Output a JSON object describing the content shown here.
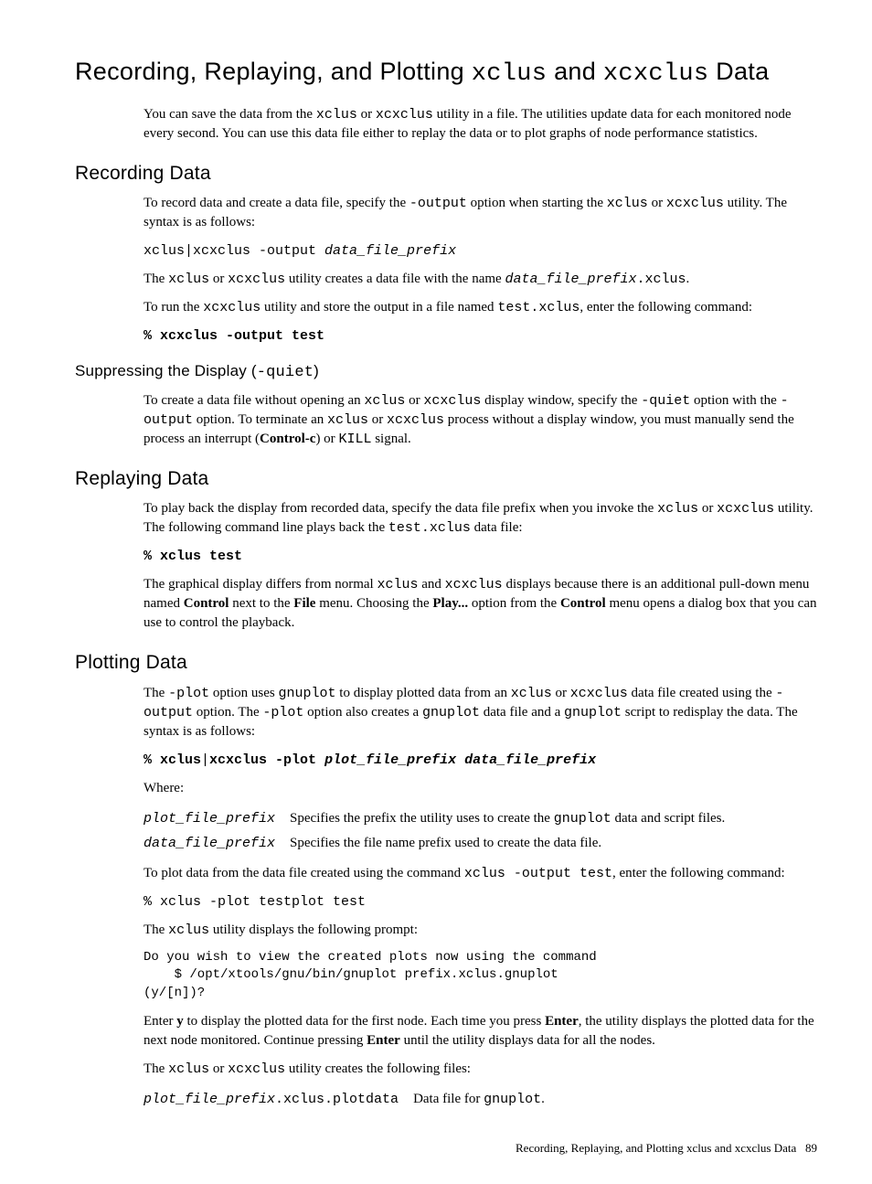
{
  "title": {
    "pre": "Recording, Replaying, and Plotting ",
    "code1": "xclus",
    "mid": " and ",
    "code2": "xcxclus",
    "post": " Data"
  },
  "intro": {
    "t1": "You can save the data from the ",
    "c1": "xclus",
    "t2": " or ",
    "c2": "xcxclus",
    "t3": " utility in a file. The utilities update data for each monitored node every second. You can use this data file either to replay the data or to plot graphs of node performance statistics."
  },
  "recording": {
    "heading": "Recording Data",
    "p1_t1": "To record data and create a data file, specify the ",
    "p1_c1": "-output",
    "p1_t2": " option when starting the ",
    "p1_c2": "xclus",
    "p1_t3": " or ",
    "p1_c3": "xcxclus",
    "p1_t4": " utility. The syntax is as follows:",
    "syntax_c1": "xclus|xcxclus -output ",
    "syntax_i1": "data_file_prefix",
    "p2_t1": "The ",
    "p2_c1": "xclus",
    "p2_t2": " or ",
    "p2_c2": "xcxclus",
    "p2_t3": " utility creates a data file with the name ",
    "p2_i1": "data_file_prefix",
    "p2_c3": ".xclus",
    "p2_t4": ".",
    "p3_t1": "To run the ",
    "p3_c1": "xcxclus",
    "p3_t2": " utility and store the output in a file named ",
    "p3_c2": "test.xclus",
    "p3_t3": ", enter the following command:",
    "cmd1": "% xcxclus -output test"
  },
  "suppress": {
    "heading_t1": "Suppressing the Display (",
    "heading_c1": "-quiet",
    "heading_t2": ")",
    "p1_t1": "To create a data file without opening an ",
    "p1_c1": "xclus",
    "p1_t2": " or ",
    "p1_c2": "xcxclus",
    "p1_t3": " display window, specify the ",
    "p1_c3": "-quiet",
    "p1_t4": " option with the  ",
    "p1_c4": "-output",
    "p1_t5": " option. To terminate an ",
    "p1_c5": "xclus",
    "p1_t6": " or ",
    "p1_c6": "xcxclus",
    "p1_t7": " process without a display window, you must manually send the process an interrupt (",
    "p1_b1": "Control-c",
    "p1_t8": ") or ",
    "p1_c7": "KILL",
    "p1_t9": " signal."
  },
  "replay": {
    "heading": "Replaying Data",
    "p1_t1": "To play back the display from recorded data, specify the data file prefix when you invoke the ",
    "p1_c1": "xclus",
    "p1_t2": " or ",
    "p1_c2": "xcxclus",
    "p1_t3": " utility. The following command line plays back the ",
    "p1_c3": "test.xclus",
    "p1_t4": " data file:",
    "cmd1": "% xclus test",
    "p2_t1": "The graphical display differs from normal ",
    "p2_c1": "xclus",
    "p2_t2": " and ",
    "p2_c2": "xcxclus",
    "p2_t3": " displays because there is an additional pull-down menu named ",
    "p2_b1": "Control",
    "p2_t4": " next to the ",
    "p2_b2": "File",
    "p2_t5": " menu. Choosing the ",
    "p2_b3": "Play...",
    "p2_t6": " option from the ",
    "p2_b4": "Control",
    "p2_t7": " menu opens a dialog box that you can use to control the playback."
  },
  "plot": {
    "heading": "Plotting Data",
    "p1_t1": "The ",
    "p1_c1": "-plot",
    "p1_t2": " option uses ",
    "p1_c2": "gnuplot",
    "p1_t3": " to display plotted data from an ",
    "p1_c3": "xclus",
    "p1_t4": " or ",
    "p1_c4": "xcxclus",
    "p1_t5": " data file created using the ",
    "p1_c5": "-output",
    "p1_t6": " option. The ",
    "p1_c6": "-plot",
    "p1_t7": " option also creates a ",
    "p1_c7": "gnuplot",
    "p1_t8": " data file and a ",
    "p1_c8": "gnuplot",
    "p1_t9": " script to redisplay the data. The syntax is as follows:",
    "cmd1_a": "% xclus",
    "cmd1_b": "|",
    "cmd1_c": "xcxclus -plot ",
    "cmd1_i1": "plot_file_prefix data_file_prefix",
    "where": "Where:",
    "row1_k": "plot_file_prefix",
    "row1_v_t1": "Specifies the prefix the utility uses to create the ",
    "row1_v_c1": "gnuplot",
    "row1_v_t2": " data and script files.",
    "row2_k": "data_file_prefix",
    "row2_v": "Specifies the file name prefix used to create the data file.",
    "p2_t1": "To plot data from the data file created using the command ",
    "p2_c1": "xclus -output test",
    "p2_t2": ", enter the following command:",
    "cmd2": "% xclus -plot testplot test",
    "p3_t1": "The ",
    "p3_c1": "xclus",
    "p3_t2": " utility displays the following prompt:",
    "code": "Do you wish to view the created plots now using the command\n    $ /opt/xtools/gnu/bin/gnuplot prefix.xclus.gnuplot\n(y/[n])?",
    "p4_t1": "Enter ",
    "p4_b1": "y",
    "p4_t2": " to display the plotted data for the first node. Each time you press ",
    "p4_b2": "Enter",
    "p4_t3": ", the utility displays the plotted data for the next node monitored. Continue pressing ",
    "p4_b3": "Enter",
    "p4_t4": " until the utility displays data for all the nodes.",
    "p5_t1": "The ",
    "p5_c1": "xclus",
    "p5_t2": " or ",
    "p5_c2": "xcxclus",
    "p5_t3": " utility creates the following files:",
    "row3_k_i": "plot_file_prefix",
    "row3_k_c": ".xclus.plotdata",
    "row3_v_t1": "Data file for ",
    "row3_v_c1": "gnuplot",
    "row3_v_t2": "."
  },
  "footer": {
    "text": "Recording, Replaying, and Plotting xclus and xcxclus Data",
    "page": "89"
  }
}
